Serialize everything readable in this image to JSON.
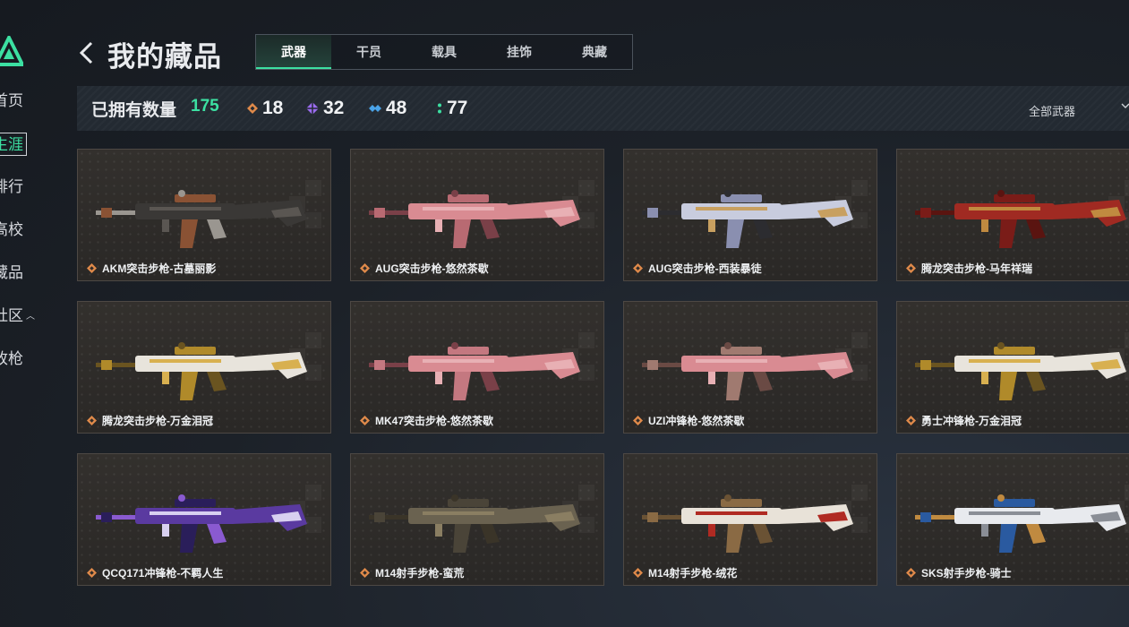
{
  "sidebar": {
    "items": [
      {
        "label": "首页",
        "active": false
      },
      {
        "label": "生涯",
        "active": true
      },
      {
        "label": "排行",
        "active": false
      },
      {
        "label": "高校",
        "active": false
      },
      {
        "label": "藏品",
        "active": false
      },
      {
        "label": "社区",
        "active": false,
        "expandable": true
      },
      {
        "label": "改枪",
        "active": false
      }
    ]
  },
  "header": {
    "title": "我的藏品",
    "tabs": [
      {
        "label": "武器",
        "active": true
      },
      {
        "label": "干员",
        "active": false
      },
      {
        "label": "载具",
        "active": false
      },
      {
        "label": "挂饰",
        "active": false
      },
      {
        "label": "典藏",
        "active": false
      }
    ]
  },
  "stats": {
    "owned_label": "已拥有数量",
    "owned_count": "175",
    "rarities": [
      {
        "icon": "orange-diamond-icon",
        "count": "18",
        "color": "#e08a4a"
      },
      {
        "icon": "purple-diamond-icon",
        "count": "32",
        "color": "#9b6cf0"
      },
      {
        "icon": "blue-diamond-icon",
        "count": "48",
        "color": "#4aa3e8"
      },
      {
        "icon": "green-dots-icon",
        "count": "77",
        "color": "#3ce0a2"
      }
    ],
    "filter_label": "全部武器"
  },
  "colors": {
    "accent": "#3ce0a2",
    "rarity_orange": "#e08a4a"
  },
  "items": [
    {
      "name": "AKM突击步枪-古墓丽影",
      "palette": [
        "#3a3836",
        "#8a5234",
        "#5a5652",
        "#9a9690"
      ]
    },
    {
      "name": "AUG突击步枪-悠然茶歇",
      "palette": [
        "#d98b92",
        "#b86a72",
        "#e8b0b4",
        "#7a4048"
      ]
    },
    {
      "name": "AUG突击步枪-西装暴徒",
      "palette": [
        "#c8ccde",
        "#8a8fb0",
        "#c8a060",
        "#2c2c30"
      ]
    },
    {
      "name": "腾龙突击步枪-马年祥瑞",
      "palette": [
        "#a02a22",
        "#7a1c18",
        "#c08a40",
        "#5a1410"
      ]
    },
    {
      "name": "腾龙突击步枪-万金泪冠",
      "palette": [
        "#e8e4dc",
        "#b08a2a",
        "#d8b050",
        "#6a5420"
      ]
    },
    {
      "name": "MK47突击步枪-悠然茶歇",
      "palette": [
        "#d98b92",
        "#c47880",
        "#e8b0b4",
        "#7a4048"
      ]
    },
    {
      "name": "UZI冲锋枪-悠然茶歇",
      "palette": [
        "#d98b92",
        "#a07a70",
        "#e8b0b4",
        "#6a4a44"
      ]
    },
    {
      "name": "勇士冲锋枪-万金泪冠",
      "palette": [
        "#e8e4dc",
        "#b08a2a",
        "#d8b050",
        "#6a5420"
      ]
    },
    {
      "name": "QCQ171冲锋枪-不羁人生",
      "palette": [
        "#5a3aa0",
        "#2a1e5a",
        "#d8d0f0",
        "#8a5ad0"
      ]
    },
    {
      "name": "M14射手步枪-蛮荒",
      "palette": [
        "#6a6250",
        "#4a4438",
        "#8a7e62",
        "#3a3428"
      ]
    },
    {
      "name": "M14射手步枪-绒花",
      "palette": [
        "#e8e2d8",
        "#8a6a44",
        "#b02a22",
        "#6a5234"
      ]
    },
    {
      "name": "SKS射手步枪-骑士",
      "palette": [
        "#e8eaee",
        "#2a5aa0",
        "#8a8e96",
        "#c08a40"
      ]
    }
  ]
}
